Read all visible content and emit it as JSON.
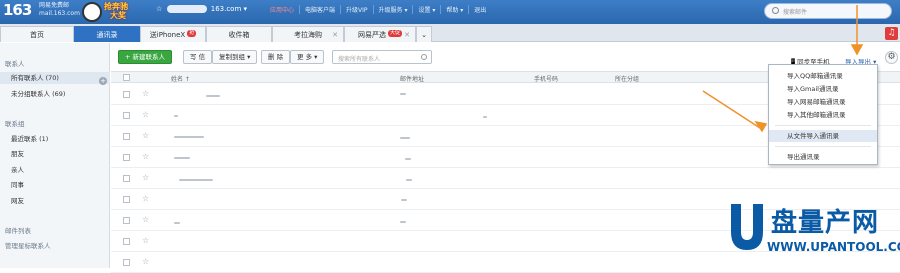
{
  "header": {
    "logo": "163",
    "logo_sub_1": "网易免费邮",
    "logo_sub_2": "mail.163.com",
    "promo_line1": "抢奔驰",
    "promo_line2": "大奖",
    "user_prefix": "☆",
    "user_suffix": "163.com ▾",
    "links": [
      "应用中心",
      "电脑客户端",
      "升级VIP",
      "升级服务 ▾",
      "设置 ▾",
      "帮助 ▾",
      "退出"
    ],
    "search_placeholder": "搜索邮件"
  },
  "tabs": [
    {
      "label": "首页"
    },
    {
      "label": "通讯录",
      "active": true
    },
    {
      "label": "送iPhoneX",
      "badge": "抢"
    },
    {
      "label": "收件箱"
    },
    {
      "label": "考拉海购"
    },
    {
      "label": "网易严选",
      "badge": "大促"
    }
  ],
  "sidebar": {
    "section1": "联系人",
    "items1": [
      "所有联系人 (70)",
      "未分组联系人 (69)"
    ],
    "section2": "联系组",
    "items2": [
      "最近联系 (1)",
      "朋友",
      "亲人",
      "同事",
      "网友"
    ],
    "section3": "邮件列表",
    "items3": [
      "管理星标联系人"
    ]
  },
  "toolbar": {
    "new_contact": "+ 新建联系人",
    "write": "写 信",
    "copy_to_group": "复制到组 ▾",
    "delete": "删 除",
    "more": "更 多 ▾",
    "search_placeholder": "搜索所有联系人",
    "sync_phone": "同步至手机",
    "import_export": "导入导出 ▾"
  },
  "table": {
    "columns": [
      "姓名 ↑",
      "邮件地址",
      "手机号码",
      "所在分组"
    ]
  },
  "menu": {
    "items": [
      "导入QQ邮箱通讯录",
      "导入Gmail通讯录",
      "导入网易邮箱通讯录",
      "导入其他邮箱通讯录",
      "从文件导入通讯录",
      "导出通讯录"
    ],
    "highlighted": "从文件导入通讯录"
  },
  "watermark": {
    "title": "盘量产网",
    "url": "WWW.UPANTOOL.COM"
  },
  "colors": {
    "header_blue": "#2a67ad",
    "active_tab": "#2f72c3",
    "new_button_green": "#3aa640",
    "annotation_orange": "#f0922a",
    "watermark_blue": "#0a5aa5"
  }
}
